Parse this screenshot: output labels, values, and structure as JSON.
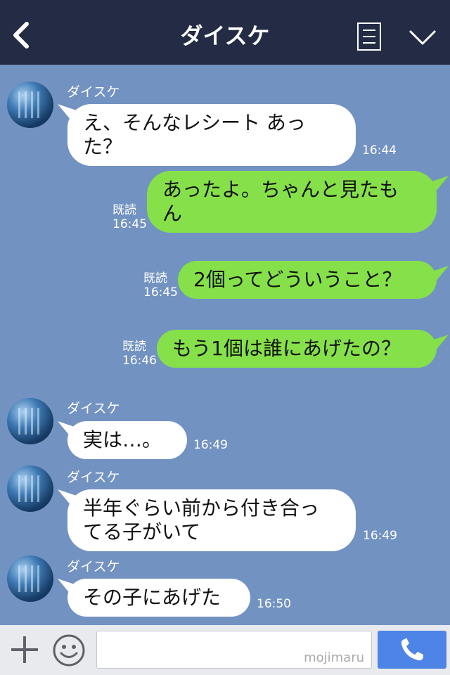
{
  "header": {
    "title": "ダイスケ",
    "back_icon": "chevron-left-icon",
    "memo_icon": "note-icon",
    "menu_icon": "chevron-down-icon"
  },
  "messages": [
    {
      "dir": "in",
      "sender": "ダイスケ",
      "text": "え、そんなレシート あった？",
      "time": "16:44"
    },
    {
      "dir": "out",
      "text": "あったよ。ちゃんと見たも ん",
      "read": "既読",
      "time": "16:45"
    },
    {
      "dir": "out",
      "text": "2個ってどういうこと？",
      "read": "既読",
      "time": "16:45"
    },
    {
      "dir": "out",
      "text": "もう1個は誰にあげたの？",
      "read": "既読",
      "time": "16:46"
    },
    {
      "dir": "in",
      "sender": "ダイスケ",
      "text": "実は…。",
      "time": "16:49"
    },
    {
      "dir": "in",
      "sender": "ダイスケ",
      "text": "半年ぐらい前から付き合っ てる子がいて",
      "time": "16:49"
    },
    {
      "dir": "in",
      "sender": "ダイスケ",
      "text": "その子にあげた",
      "time": "16:50"
    }
  ],
  "footer": {
    "input_value": "",
    "watermark": "mojimaru",
    "plus_icon": "plus-icon",
    "emoji_icon": "smile-icon",
    "call_icon": "phone-icon"
  },
  "colors": {
    "header": "#232c44",
    "background": "#7292c2",
    "bubble_out": "#86e04a",
    "bubble_in": "#ffffff",
    "call_button": "#4d84e6"
  }
}
